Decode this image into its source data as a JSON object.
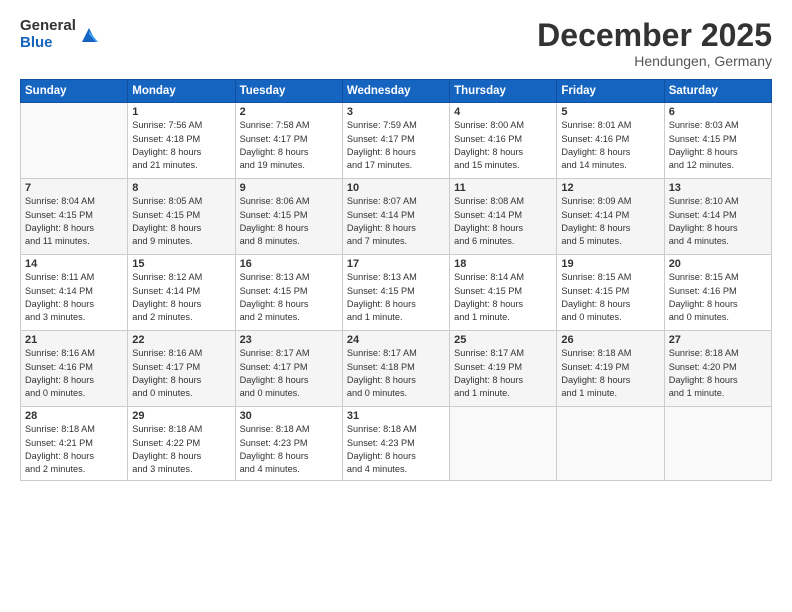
{
  "logo": {
    "general": "General",
    "blue": "Blue"
  },
  "title": "December 2025",
  "subtitle": "Hendungen, Germany",
  "days_header": [
    "Sunday",
    "Monday",
    "Tuesday",
    "Wednesday",
    "Thursday",
    "Friday",
    "Saturday"
  ],
  "weeks": [
    [
      {
        "num": "",
        "info": ""
      },
      {
        "num": "1",
        "info": "Sunrise: 7:56 AM\nSunset: 4:18 PM\nDaylight: 8 hours\nand 21 minutes."
      },
      {
        "num": "2",
        "info": "Sunrise: 7:58 AM\nSunset: 4:17 PM\nDaylight: 8 hours\nand 19 minutes."
      },
      {
        "num": "3",
        "info": "Sunrise: 7:59 AM\nSunset: 4:17 PM\nDaylight: 8 hours\nand 17 minutes."
      },
      {
        "num": "4",
        "info": "Sunrise: 8:00 AM\nSunset: 4:16 PM\nDaylight: 8 hours\nand 15 minutes."
      },
      {
        "num": "5",
        "info": "Sunrise: 8:01 AM\nSunset: 4:16 PM\nDaylight: 8 hours\nand 14 minutes."
      },
      {
        "num": "6",
        "info": "Sunrise: 8:03 AM\nSunset: 4:15 PM\nDaylight: 8 hours\nand 12 minutes."
      }
    ],
    [
      {
        "num": "7",
        "info": "Sunrise: 8:04 AM\nSunset: 4:15 PM\nDaylight: 8 hours\nand 11 minutes."
      },
      {
        "num": "8",
        "info": "Sunrise: 8:05 AM\nSunset: 4:15 PM\nDaylight: 8 hours\nand 9 minutes."
      },
      {
        "num": "9",
        "info": "Sunrise: 8:06 AM\nSunset: 4:15 PM\nDaylight: 8 hours\nand 8 minutes."
      },
      {
        "num": "10",
        "info": "Sunrise: 8:07 AM\nSunset: 4:14 PM\nDaylight: 8 hours\nand 7 minutes."
      },
      {
        "num": "11",
        "info": "Sunrise: 8:08 AM\nSunset: 4:14 PM\nDaylight: 8 hours\nand 6 minutes."
      },
      {
        "num": "12",
        "info": "Sunrise: 8:09 AM\nSunset: 4:14 PM\nDaylight: 8 hours\nand 5 minutes."
      },
      {
        "num": "13",
        "info": "Sunrise: 8:10 AM\nSunset: 4:14 PM\nDaylight: 8 hours\nand 4 minutes."
      }
    ],
    [
      {
        "num": "14",
        "info": "Sunrise: 8:11 AM\nSunset: 4:14 PM\nDaylight: 8 hours\nand 3 minutes."
      },
      {
        "num": "15",
        "info": "Sunrise: 8:12 AM\nSunset: 4:14 PM\nDaylight: 8 hours\nand 2 minutes."
      },
      {
        "num": "16",
        "info": "Sunrise: 8:13 AM\nSunset: 4:15 PM\nDaylight: 8 hours\nand 2 minutes."
      },
      {
        "num": "17",
        "info": "Sunrise: 8:13 AM\nSunset: 4:15 PM\nDaylight: 8 hours\nand 1 minute."
      },
      {
        "num": "18",
        "info": "Sunrise: 8:14 AM\nSunset: 4:15 PM\nDaylight: 8 hours\nand 1 minute."
      },
      {
        "num": "19",
        "info": "Sunrise: 8:15 AM\nSunset: 4:15 PM\nDaylight: 8 hours\nand 0 minutes."
      },
      {
        "num": "20",
        "info": "Sunrise: 8:15 AM\nSunset: 4:16 PM\nDaylight: 8 hours\nand 0 minutes."
      }
    ],
    [
      {
        "num": "21",
        "info": "Sunrise: 8:16 AM\nSunset: 4:16 PM\nDaylight: 8 hours\nand 0 minutes."
      },
      {
        "num": "22",
        "info": "Sunrise: 8:16 AM\nSunset: 4:17 PM\nDaylight: 8 hours\nand 0 minutes."
      },
      {
        "num": "23",
        "info": "Sunrise: 8:17 AM\nSunset: 4:17 PM\nDaylight: 8 hours\nand 0 minutes."
      },
      {
        "num": "24",
        "info": "Sunrise: 8:17 AM\nSunset: 4:18 PM\nDaylight: 8 hours\nand 0 minutes."
      },
      {
        "num": "25",
        "info": "Sunrise: 8:17 AM\nSunset: 4:19 PM\nDaylight: 8 hours\nand 1 minute."
      },
      {
        "num": "26",
        "info": "Sunrise: 8:18 AM\nSunset: 4:19 PM\nDaylight: 8 hours\nand 1 minute."
      },
      {
        "num": "27",
        "info": "Sunrise: 8:18 AM\nSunset: 4:20 PM\nDaylight: 8 hours\nand 1 minute."
      }
    ],
    [
      {
        "num": "28",
        "info": "Sunrise: 8:18 AM\nSunset: 4:21 PM\nDaylight: 8 hours\nand 2 minutes."
      },
      {
        "num": "29",
        "info": "Sunrise: 8:18 AM\nSunset: 4:22 PM\nDaylight: 8 hours\nand 3 minutes."
      },
      {
        "num": "30",
        "info": "Sunrise: 8:18 AM\nSunset: 4:23 PM\nDaylight: 8 hours\nand 4 minutes."
      },
      {
        "num": "31",
        "info": "Sunrise: 8:18 AM\nSunset: 4:23 PM\nDaylight: 8 hours\nand 4 minutes."
      },
      {
        "num": "",
        "info": ""
      },
      {
        "num": "",
        "info": ""
      },
      {
        "num": "",
        "info": ""
      }
    ]
  ]
}
